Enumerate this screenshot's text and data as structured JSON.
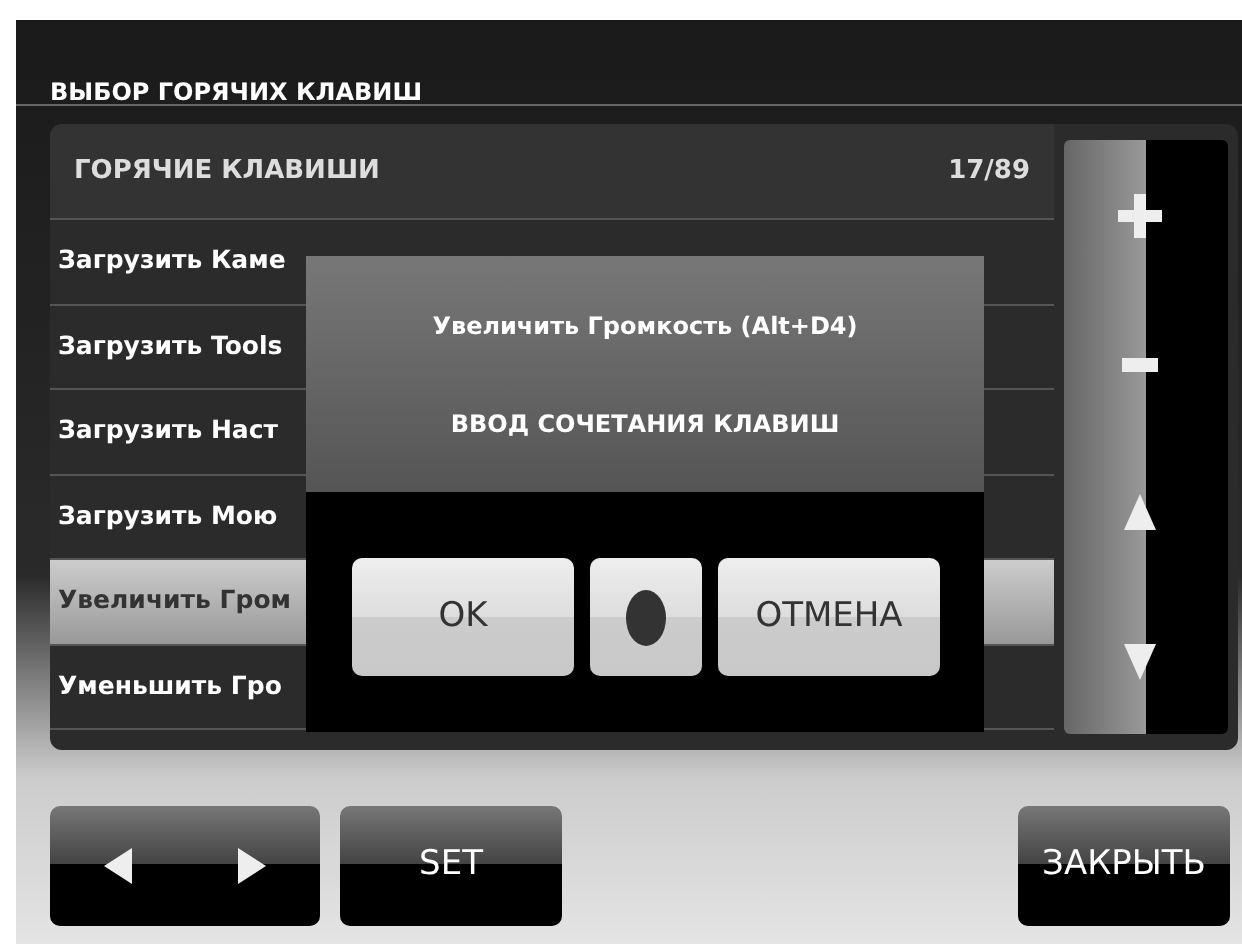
{
  "title": "ВЫБОР ГОРЯЧИХ КЛАВИШ",
  "list": {
    "header": "ГОРЯЧИЕ КЛАВИШИ",
    "count": "17/89",
    "rows": [
      {
        "label": "Загрузить Каме",
        "selected": false
      },
      {
        "label": "Загрузить Tools",
        "selected": false
      },
      {
        "label": "Загрузить Наст",
        "selected": false
      },
      {
        "label": "Загрузить Мою",
        "selected": false
      },
      {
        "label": "Увеличить Гром",
        "selected": true
      },
      {
        "label": "Уменьшить Гро",
        "selected": false
      }
    ]
  },
  "dialog": {
    "title": "Увеличить Громкость (Alt+D4)",
    "prompt": "ВВОД СОЧЕТАНИЯ КЛАВИШ",
    "ok": "OK",
    "cancel": "ОТМЕНА"
  },
  "bottom": {
    "set": "SET",
    "close": "ЗАКРЫТЬ"
  }
}
